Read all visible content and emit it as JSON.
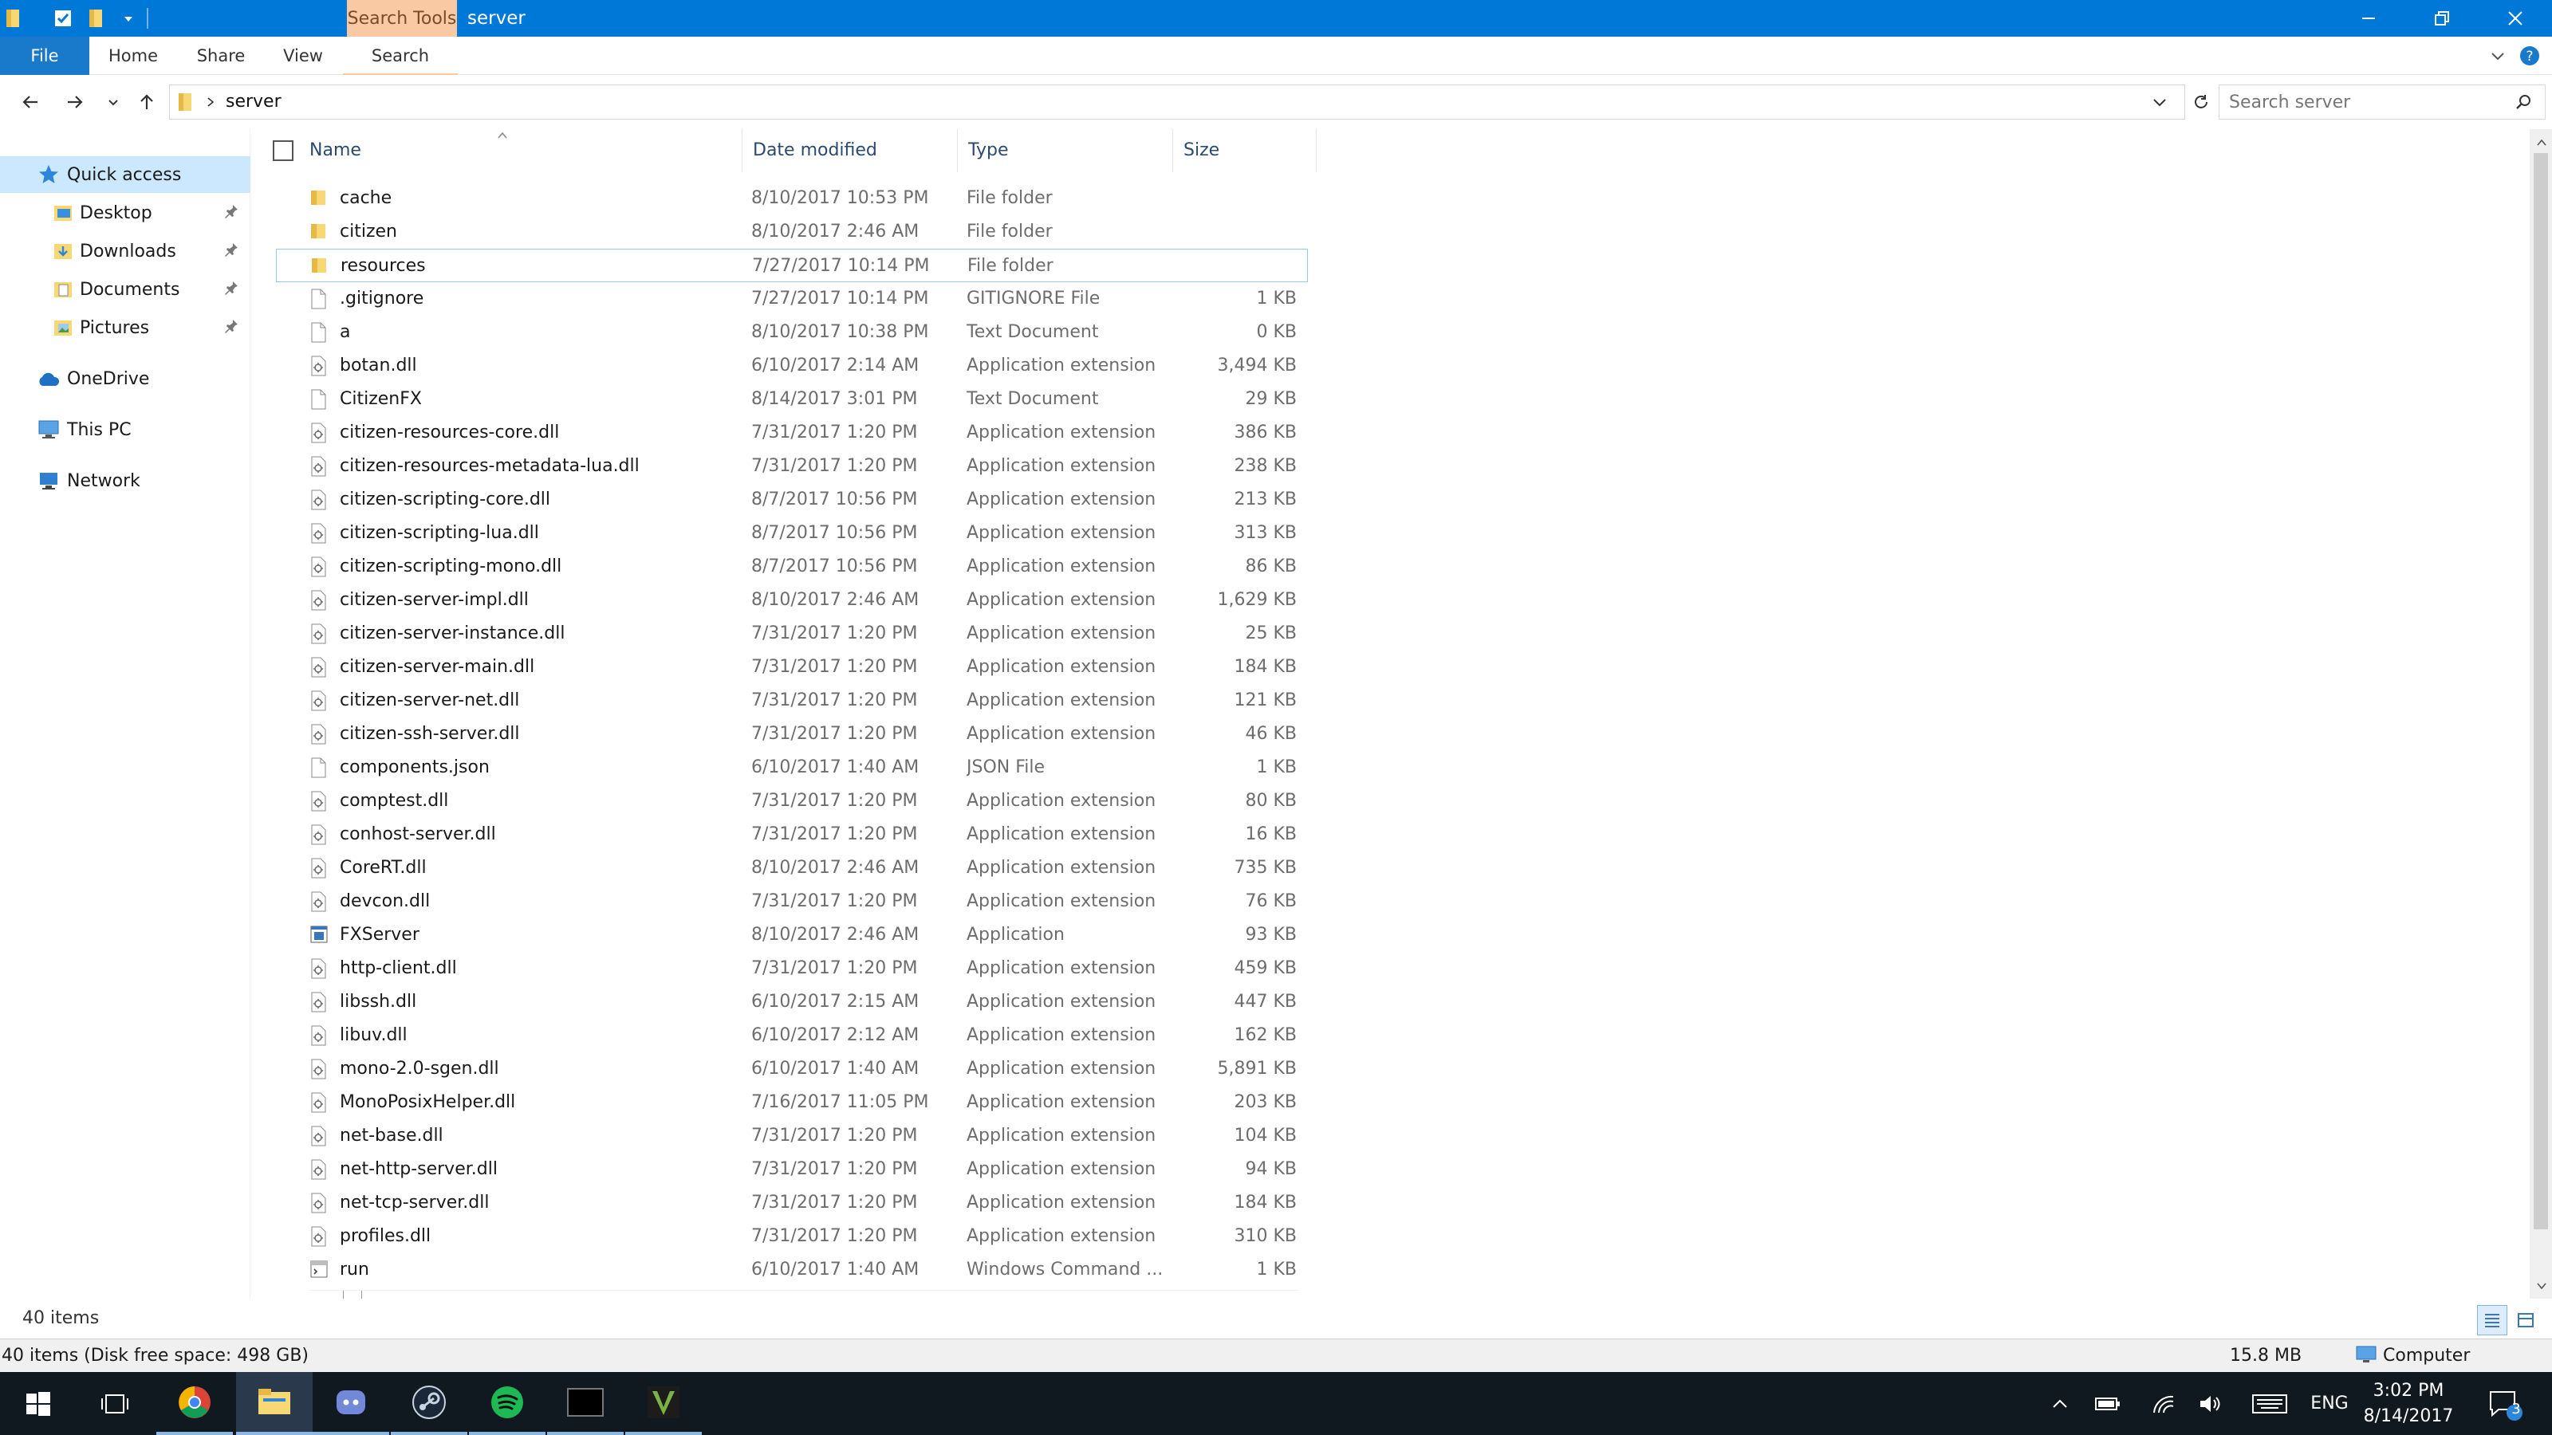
{
  "titlebar": {
    "context_tab": "Search Tools",
    "title": "server",
    "accent": "#0078d7"
  },
  "ribbon": {
    "tabs": [
      "File",
      "Home",
      "Share",
      "View",
      "Search"
    ]
  },
  "address": {
    "path": "server",
    "search_placeholder": "Search server"
  },
  "navpane": {
    "quick_access": "Quick access",
    "pinned": [
      {
        "label": "Desktop",
        "icon": "desktop-folder-icon"
      },
      {
        "label": "Downloads",
        "icon": "downloads-folder-icon"
      },
      {
        "label": "Documents",
        "icon": "documents-folder-icon"
      },
      {
        "label": "Pictures",
        "icon": "pictures-folder-icon"
      }
    ],
    "onedrive": "OneDrive",
    "this_pc": "This PC",
    "network": "Network"
  },
  "columns": {
    "name": "Name",
    "date": "Date modified",
    "type": "Type",
    "size": "Size"
  },
  "files": [
    {
      "name": "cache",
      "date": "8/10/2017 10:53 PM",
      "type": "File folder",
      "size": "",
      "kind": "folder"
    },
    {
      "name": "citizen",
      "date": "8/10/2017 2:46 AM",
      "type": "File folder",
      "size": "",
      "kind": "folder"
    },
    {
      "name": "resources",
      "date": "7/27/2017 10:14 PM",
      "type": "File folder",
      "size": "",
      "kind": "folder"
    },
    {
      "name": ".gitignore",
      "date": "7/27/2017 10:14 PM",
      "type": "GITIGNORE File",
      "size": "1 KB",
      "kind": "file"
    },
    {
      "name": "a",
      "date": "8/10/2017 10:38 PM",
      "type": "Text Document",
      "size": "0 KB",
      "kind": "file"
    },
    {
      "name": "botan.dll",
      "date": "6/10/2017 2:14 AM",
      "type": "Application extension",
      "size": "3,494 KB",
      "kind": "dll"
    },
    {
      "name": "CitizenFX",
      "date": "8/14/2017 3:01 PM",
      "type": "Text Document",
      "size": "29 KB",
      "kind": "file"
    },
    {
      "name": "citizen-resources-core.dll",
      "date": "7/31/2017 1:20 PM",
      "type": "Application extension",
      "size": "386 KB",
      "kind": "dll"
    },
    {
      "name": "citizen-resources-metadata-lua.dll",
      "date": "7/31/2017 1:20 PM",
      "type": "Application extension",
      "size": "238 KB",
      "kind": "dll"
    },
    {
      "name": "citizen-scripting-core.dll",
      "date": "8/7/2017 10:56 PM",
      "type": "Application extension",
      "size": "213 KB",
      "kind": "dll"
    },
    {
      "name": "citizen-scripting-lua.dll",
      "date": "8/7/2017 10:56 PM",
      "type": "Application extension",
      "size": "313 KB",
      "kind": "dll"
    },
    {
      "name": "citizen-scripting-mono.dll",
      "date": "8/7/2017 10:56 PM",
      "type": "Application extension",
      "size": "86 KB",
      "kind": "dll"
    },
    {
      "name": "citizen-server-impl.dll",
      "date": "8/10/2017 2:46 AM",
      "type": "Application extension",
      "size": "1,629 KB",
      "kind": "dll"
    },
    {
      "name": "citizen-server-instance.dll",
      "date": "7/31/2017 1:20 PM",
      "type": "Application extension",
      "size": "25 KB",
      "kind": "dll"
    },
    {
      "name": "citizen-server-main.dll",
      "date": "7/31/2017 1:20 PM",
      "type": "Application extension",
      "size": "184 KB",
      "kind": "dll"
    },
    {
      "name": "citizen-server-net.dll",
      "date": "7/31/2017 1:20 PM",
      "type": "Application extension",
      "size": "121 KB",
      "kind": "dll"
    },
    {
      "name": "citizen-ssh-server.dll",
      "date": "7/31/2017 1:20 PM",
      "type": "Application extension",
      "size": "46 KB",
      "kind": "dll"
    },
    {
      "name": "components.json",
      "date": "6/10/2017 1:40 AM",
      "type": "JSON File",
      "size": "1 KB",
      "kind": "file"
    },
    {
      "name": "comptest.dll",
      "date": "7/31/2017 1:20 PM",
      "type": "Application extension",
      "size": "80 KB",
      "kind": "dll"
    },
    {
      "name": "conhost-server.dll",
      "date": "7/31/2017 1:20 PM",
      "type": "Application extension",
      "size": "16 KB",
      "kind": "dll"
    },
    {
      "name": "CoreRT.dll",
      "date": "8/10/2017 2:46 AM",
      "type": "Application extension",
      "size": "735 KB",
      "kind": "dll"
    },
    {
      "name": "devcon.dll",
      "date": "7/31/2017 1:20 PM",
      "type": "Application extension",
      "size": "76 KB",
      "kind": "dll"
    },
    {
      "name": "FXServer",
      "date": "8/10/2017 2:46 AM",
      "type": "Application",
      "size": "93 KB",
      "kind": "exe"
    },
    {
      "name": "http-client.dll",
      "date": "7/31/2017 1:20 PM",
      "type": "Application extension",
      "size": "459 KB",
      "kind": "dll"
    },
    {
      "name": "libssh.dll",
      "date": "6/10/2017 2:15 AM",
      "type": "Application extension",
      "size": "447 KB",
      "kind": "dll"
    },
    {
      "name": "libuv.dll",
      "date": "6/10/2017 2:12 AM",
      "type": "Application extension",
      "size": "162 KB",
      "kind": "dll"
    },
    {
      "name": "mono-2.0-sgen.dll",
      "date": "6/10/2017 1:40 AM",
      "type": "Application extension",
      "size": "5,891 KB",
      "kind": "dll"
    },
    {
      "name": "MonoPosixHelper.dll",
      "date": "7/16/2017 11:05 PM",
      "type": "Application extension",
      "size": "203 KB",
      "kind": "dll"
    },
    {
      "name": "net-base.dll",
      "date": "7/31/2017 1:20 PM",
      "type": "Application extension",
      "size": "104 KB",
      "kind": "dll"
    },
    {
      "name": "net-http-server.dll",
      "date": "7/31/2017 1:20 PM",
      "type": "Application extension",
      "size": "94 KB",
      "kind": "dll"
    },
    {
      "name": "net-tcp-server.dll",
      "date": "7/31/2017 1:20 PM",
      "type": "Application extension",
      "size": "184 KB",
      "kind": "dll"
    },
    {
      "name": "profiles.dll",
      "date": "7/31/2017 1:20 PM",
      "type": "Application extension",
      "size": "310 KB",
      "kind": "dll"
    },
    {
      "name": "run",
      "date": "6/10/2017 1:40 AM",
      "type": "Windows Command ...",
      "size": "1 KB",
      "kind": "cmd"
    }
  ],
  "focused_row": "resources",
  "status": {
    "items": "40 items",
    "disk": "40 items (Disk free space: 498 GB)",
    "size": "15.8 MB",
    "location": "Computer"
  },
  "taskbar": {
    "apps": [
      "start-icon",
      "task-view-icon",
      "chrome-icon",
      "file-explorer-icon",
      "discord-icon",
      "steam-icon",
      "spotify-icon",
      "terminal-icon",
      "gta-v-icon"
    ],
    "language": "ENG",
    "time": "3:02 PM",
    "date": "8/14/2017",
    "notifications": "3"
  }
}
